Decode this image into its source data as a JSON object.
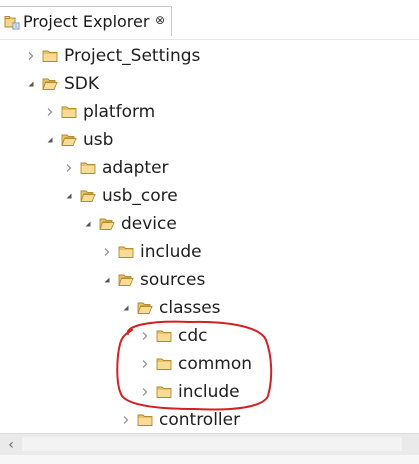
{
  "view": {
    "title": "Project Explorer",
    "close_glyph": "⊗",
    "icon": "project-explorer-icon"
  },
  "tree": [
    {
      "label": "Project_Settings",
      "expanded": false,
      "icon": "folder-icon"
    },
    {
      "label": "SDK",
      "expanded": true,
      "icon": "folder-open-icon"
    },
    {
      "label": "platform",
      "expanded": false,
      "icon": "folder-icon"
    },
    {
      "label": "usb",
      "expanded": true,
      "icon": "folder-open-icon"
    },
    {
      "label": "adapter",
      "expanded": false,
      "icon": "folder-icon"
    },
    {
      "label": "usb_core",
      "expanded": true,
      "icon": "folder-open-icon"
    },
    {
      "label": "device",
      "expanded": true,
      "icon": "folder-open-icon"
    },
    {
      "label": "include",
      "expanded": false,
      "icon": "folder-icon"
    },
    {
      "label": "sources",
      "expanded": true,
      "icon": "folder-open-icon"
    },
    {
      "label": "classes",
      "expanded": true,
      "icon": "folder-open-icon"
    },
    {
      "label": "cdc",
      "expanded": false,
      "icon": "folder-icon"
    },
    {
      "label": "common",
      "expanded": false,
      "icon": "folder-icon"
    },
    {
      "label": "include",
      "expanded": false,
      "icon": "folder-icon"
    },
    {
      "label": "controller",
      "expanded": false,
      "icon": "folder-icon"
    }
  ],
  "scrollbar": {
    "left_arrow": "‹"
  },
  "colors": {
    "folder": "#e8c16a",
    "folder_dark": "#b58a2c",
    "annotation": "#d42020",
    "twisty": "#8a8a8a"
  }
}
